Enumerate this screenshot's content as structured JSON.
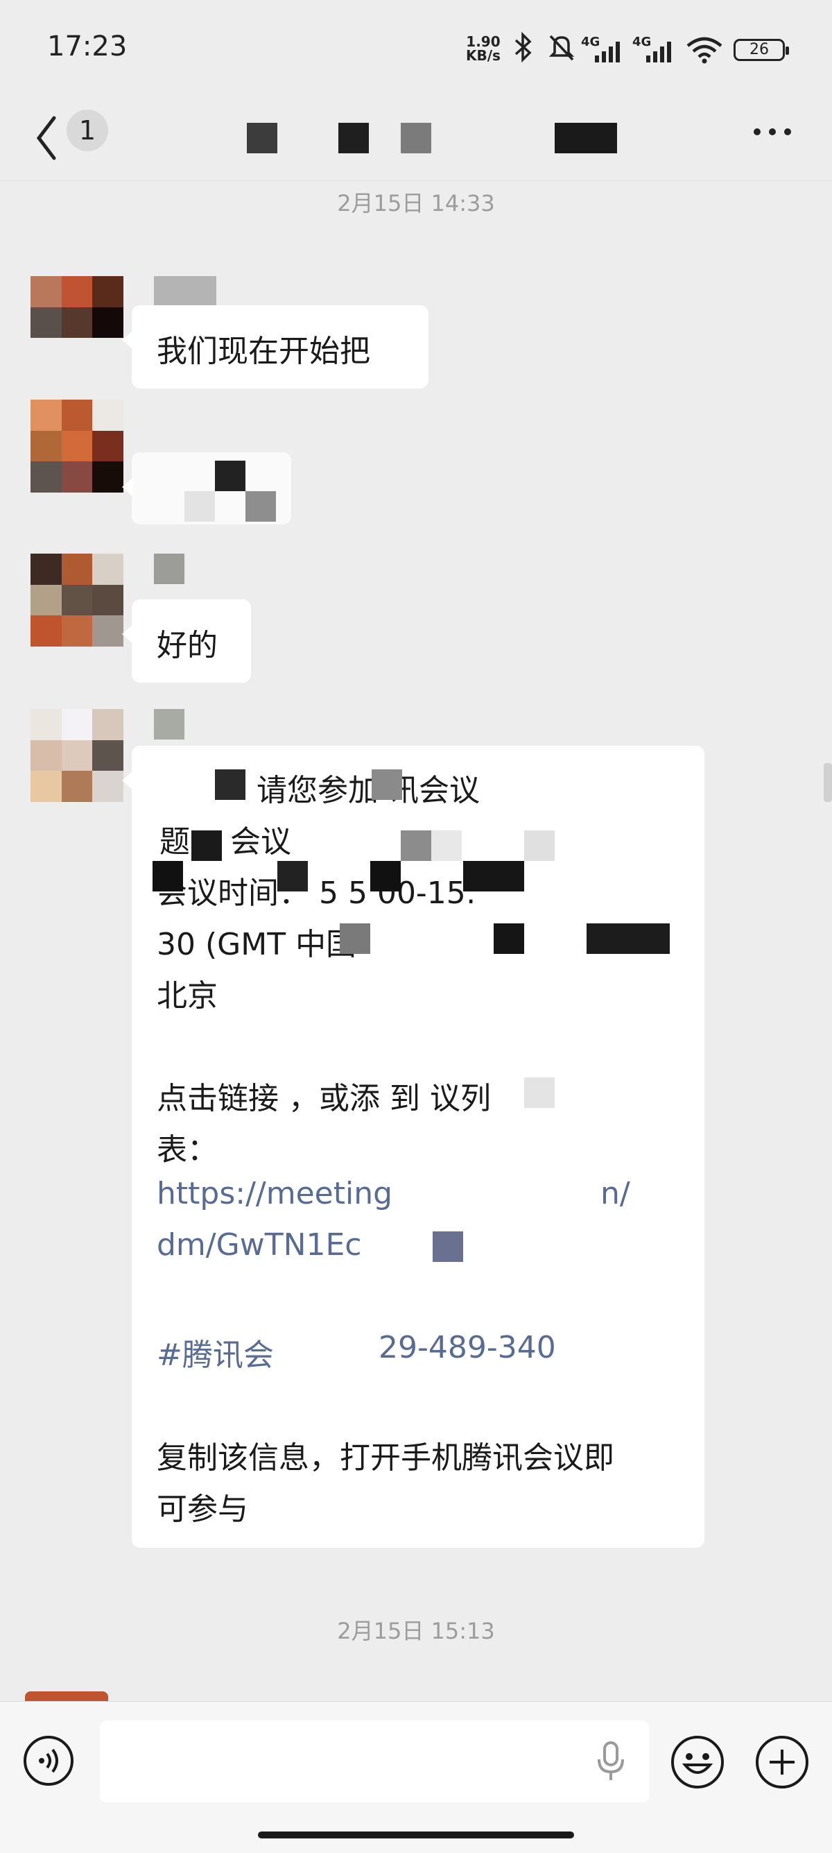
{
  "status_bar": {
    "time": "17:23",
    "net_speed_value": "1.90",
    "net_speed_unit": "KB/s",
    "signal_1_label": "4G",
    "signal_2_label": "4G",
    "battery_level": "26",
    "icons": [
      "bluetooth-icon",
      "mute-icon",
      "signal-icon",
      "wifi-icon",
      "battery-icon"
    ]
  },
  "header": {
    "back_icon": "chevron-left-icon",
    "unread_count": "1",
    "more_icon": "ellipsis-icon"
  },
  "timestamps": [
    "2月15日 14:33",
    "2月15日 15:13"
  ],
  "messages": [
    {
      "text": "我们现在开始把"
    },
    {
      "text": ""
    },
    {
      "text": "好的"
    }
  ],
  "meeting_card": {
    "line1": "请您参加   讯会议",
    "line2": "  题：            会议",
    "line3": "会议时间：      5          5  00-15:",
    "line4": "30 (GMT          中国",
    "line5": "北京",
    "line6": "点击链接        ，或添   到      议列",
    "line7": "表：",
    "link_line1": "https://meeting",
    "link_line1_end": "n/",
    "link_line2": "dm/GwTN1Ec",
    "tag_prefix": "#腾讯会",
    "tag_suffix": "29-489-340",
    "footer1": "复制该信息，打开手机腾讯会议即",
    "footer2": "可参与"
  },
  "input_bar": {
    "placeholder": "",
    "icons": [
      "voice-icon",
      "mic-icon",
      "emoji-icon",
      "plus-icon"
    ]
  },
  "colors": {
    "background": "#ededed",
    "bubble": "#ffffff",
    "link": "#576b95",
    "timestamp": "#9c9c9c"
  }
}
